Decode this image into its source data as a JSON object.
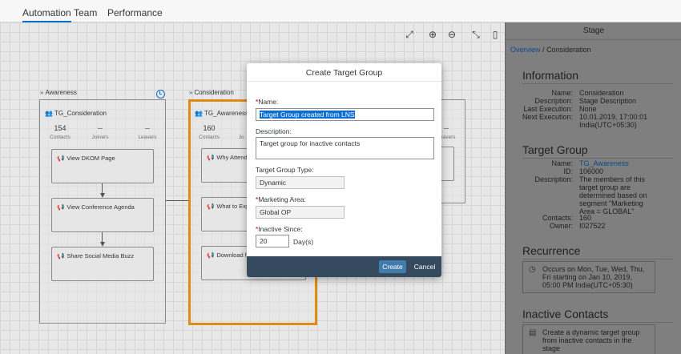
{
  "tabs": [
    {
      "label": "Automation",
      "active": true
    },
    {
      "label": "Team",
      "active": false
    },
    {
      "label": "Performance",
      "active": false
    }
  ],
  "toolbar_icons": [
    "fit-to-screen-icon",
    "zoom-in-icon",
    "zoom-out-icon",
    "collapse-icon",
    "side-panel-icon"
  ],
  "canvas": {
    "stages": [
      {
        "name": "Awareness"
      },
      {
        "name": "Consideration",
        "selected": true
      }
    ],
    "groups": [
      {
        "title": "TG_Consideration",
        "stats": [
          {
            "value": "154",
            "label": "Contacts"
          },
          {
            "value": "--",
            "label": "Joiners"
          },
          {
            "value": "--",
            "label": "Leavers"
          }
        ],
        "actions": [
          "View DKOM Page",
          "View Conference Agenda",
          "Share Social Media Buzz"
        ]
      },
      {
        "title": "TG_Awareness",
        "stats": [
          {
            "value": "160",
            "label": "Contacts"
          },
          {
            "value": "Jo",
            "label": ""
          }
        ],
        "actions": [
          "Why Attend",
          "What to Exp",
          "Download f"
        ]
      },
      {
        "stats": [
          {
            "value": "--",
            "label": "Leavers"
          }
        ]
      }
    ]
  },
  "panel": {
    "title": "Stage",
    "breadcrumb": {
      "link": "Overview",
      "sep": "/",
      "current": "Consideration"
    },
    "information": {
      "title": "Information",
      "rows": [
        {
          "k": "Name:",
          "v": "Consideration"
        },
        {
          "k": "Description:",
          "v": "Stage Description"
        },
        {
          "k": "Last Execution:",
          "v": "None"
        },
        {
          "k": "Next Execution:",
          "v": "10.01.2019, 17:00:01 India(UTC+05:30)"
        }
      ]
    },
    "target_group": {
      "title": "Target Group",
      "rows": [
        {
          "k": "Name:",
          "v": "TG_Awareness"
        },
        {
          "k": "ID:",
          "v": "106000"
        },
        {
          "k": "Description:",
          "v": "The members of this target group are determined based on segment \"Marketing Area = GLOBAL\""
        },
        {
          "k": "Contacts:",
          "v": "160"
        },
        {
          "k": "Owner:",
          "v": "I027522"
        }
      ]
    },
    "recurrence": {
      "title": "Recurrence",
      "text": "Occurs on Mon, Tue, Wed, Thu, Fri starting on Jan 10, 2019, 05:00 PM India(UTC+05:30)"
    },
    "inactive_contacts": {
      "title": "Inactive Contacts",
      "text": "Create a dynamic target group from inactive contacts in the stage"
    }
  },
  "dialog": {
    "title": "Create Target Group",
    "name_label": "Name:",
    "name_value": "Target Group created from LNS",
    "description_label": "Description:",
    "description_value": "Target group for inactive contacts",
    "type_label": "Target Group Type:",
    "type_value": "Dynamic",
    "area_label": "Marketing Area:",
    "area_value": "Global OP",
    "inactive_label": "Inactive Since:",
    "inactive_value": "20",
    "inactive_unit": "Day(s)",
    "create_label": "Create",
    "cancel_label": "Cancel"
  },
  "colors": {
    "accent": "#0a6ed1",
    "selected_stage_border": "#e08b16",
    "dialog_footer": "#354a5f",
    "create_button": "#427cac",
    "required_marker": "#bb0000"
  }
}
